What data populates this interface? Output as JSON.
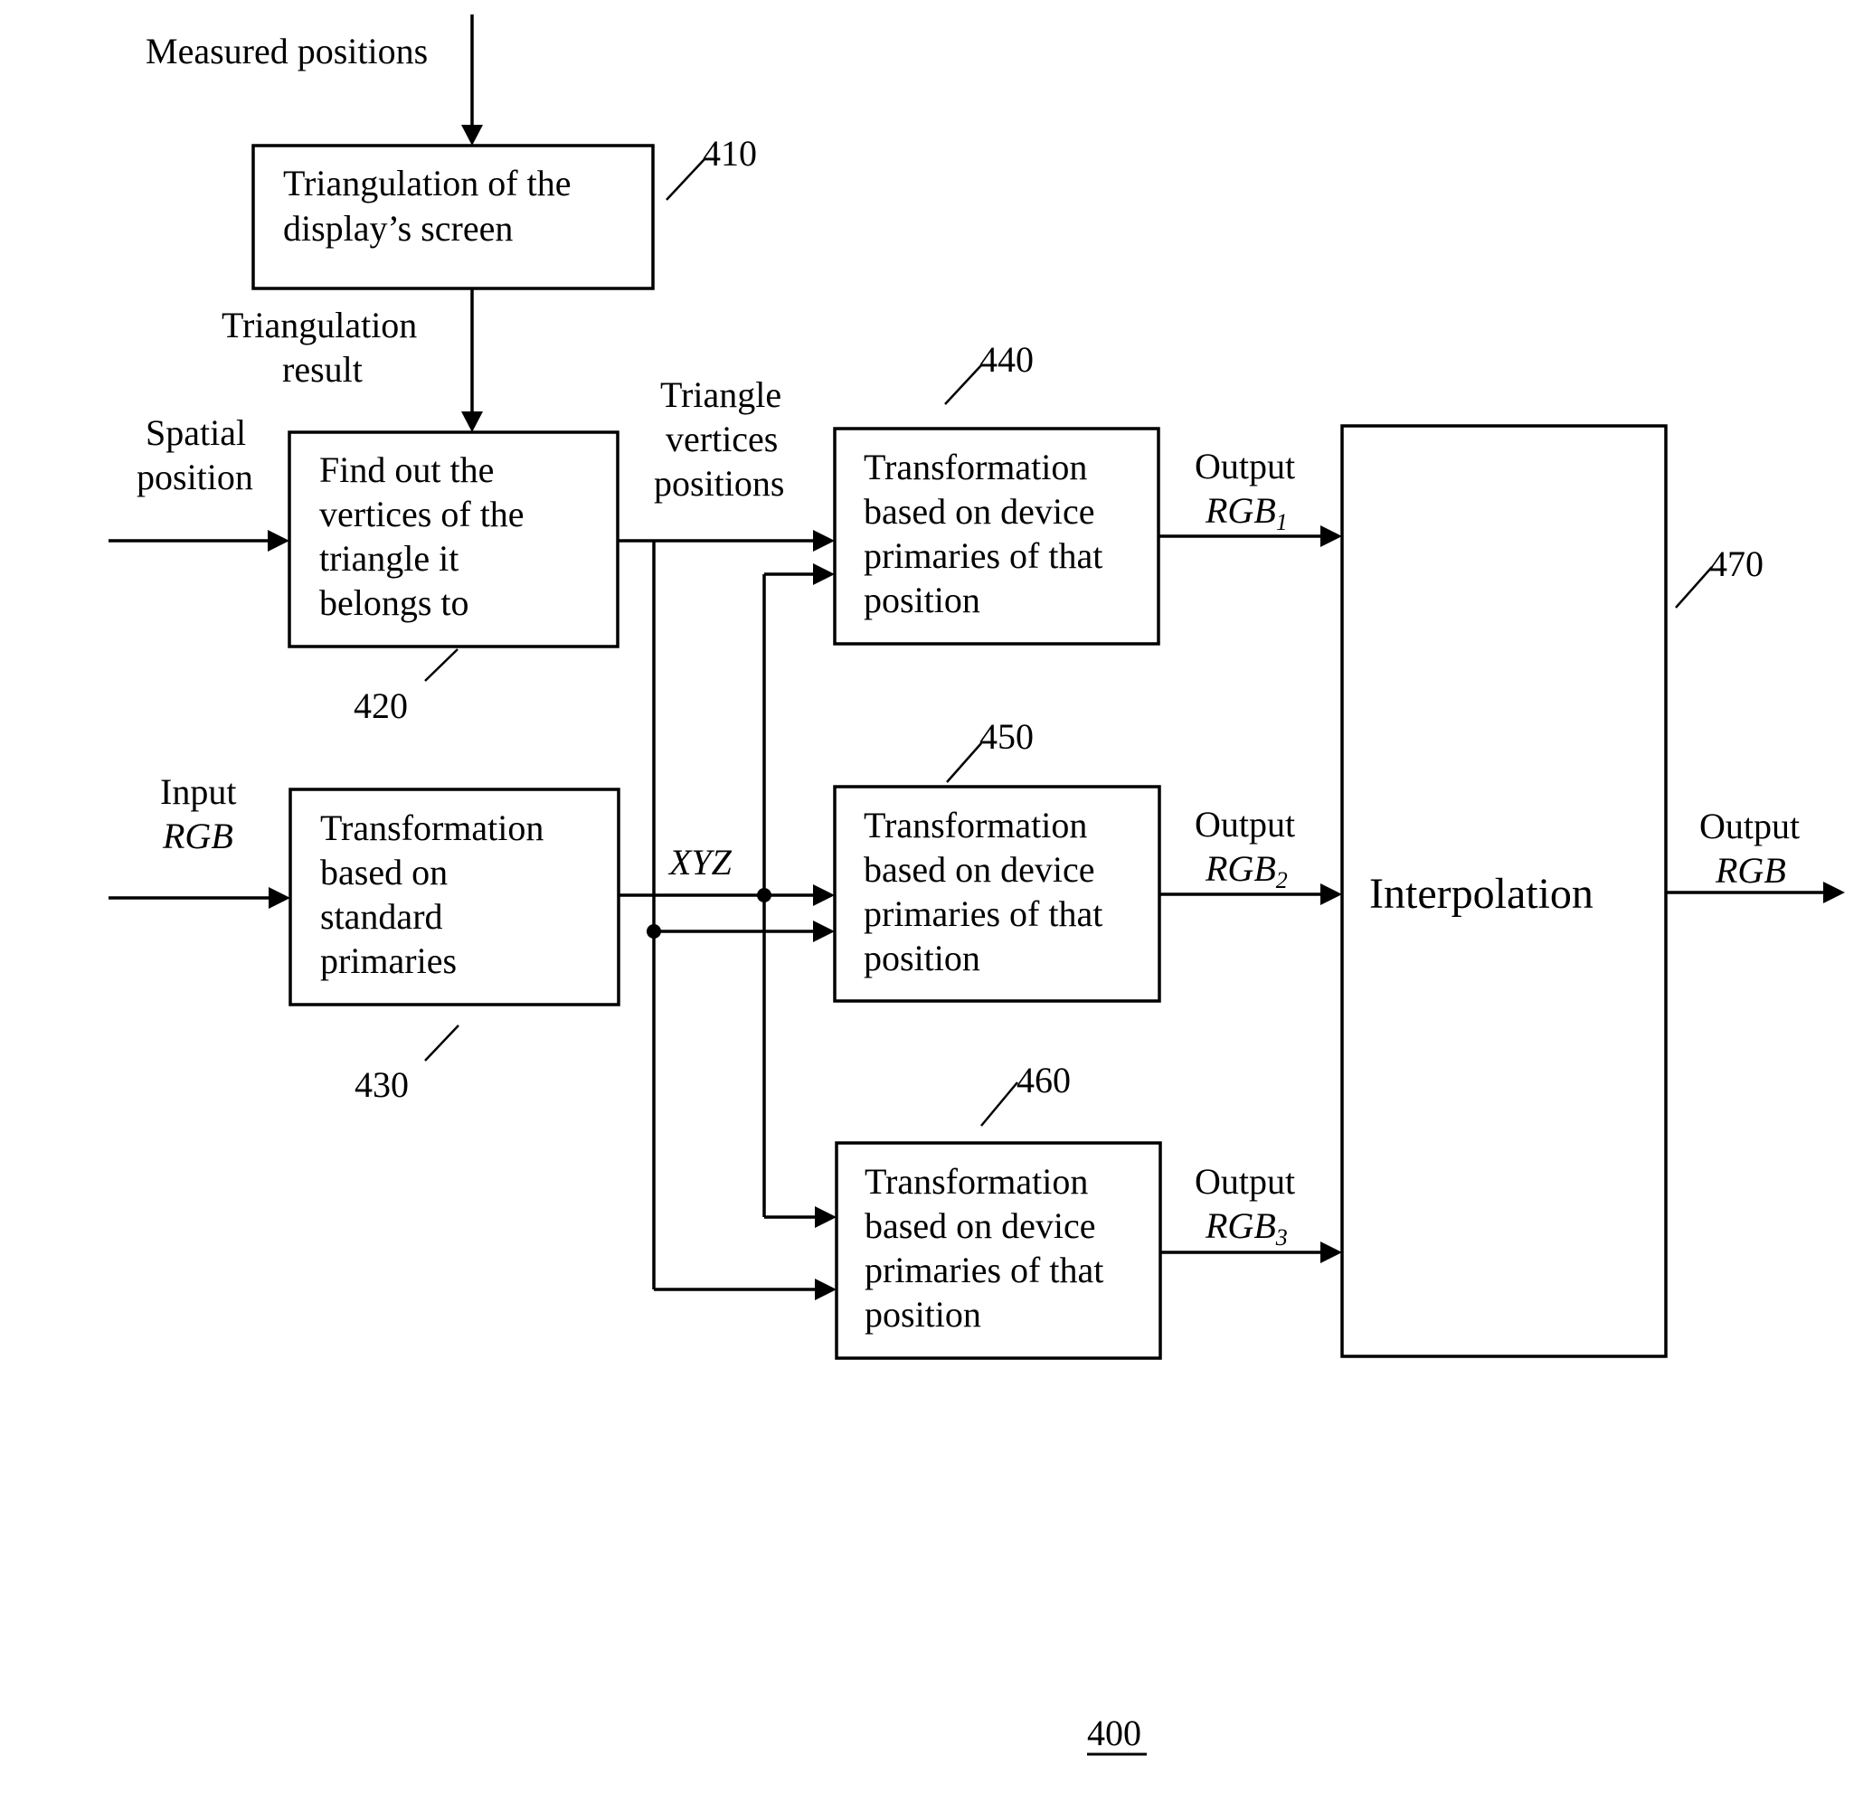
{
  "figure_number": "400",
  "blocks": {
    "b410": {
      "ref": "410",
      "lines": [
        "Triangulation of the",
        "display’s screen"
      ]
    },
    "b420": {
      "ref": "420",
      "lines": [
        "Find out the",
        "vertices of the",
        "triangle it",
        "belongs to"
      ]
    },
    "b430": {
      "ref": "430",
      "lines": [
        "Transformation",
        "based on",
        "standard",
        "primaries"
      ]
    },
    "b440": {
      "ref": "440",
      "lines": [
        "Transformation",
        "based on device",
        "primaries of that",
        "position"
      ]
    },
    "b450": {
      "ref": "450",
      "lines": [
        "Transformation",
        "based on device",
        "primaries of that",
        "position"
      ]
    },
    "b460": {
      "ref": "460",
      "lines": [
        "Transformation",
        "based on device",
        "primaries of that",
        "position"
      ]
    },
    "b470": {
      "ref": "470",
      "label": "Interpolation"
    }
  },
  "signals": {
    "measured_positions": "Measured positions",
    "triangulation_result": [
      "Triangulation",
      "result"
    ],
    "spatial_position": [
      "Spatial",
      "position"
    ],
    "triangle_vertices_positions": [
      "Triangle",
      "vertices",
      "positions"
    ],
    "input_rgb": {
      "line1": "Input",
      "line2": "RGB"
    },
    "xyz": "XYZ",
    "output_rgb1": {
      "line1": "Output",
      "main": "RGB",
      "sub": "1"
    },
    "output_rgb2": {
      "line1": "Output",
      "main": "RGB",
      "sub": "2"
    },
    "output_rgb3": {
      "line1": "Output",
      "main": "RGB",
      "sub": "3"
    },
    "output_rgb": {
      "line1": "Output",
      "line2": "RGB"
    }
  }
}
